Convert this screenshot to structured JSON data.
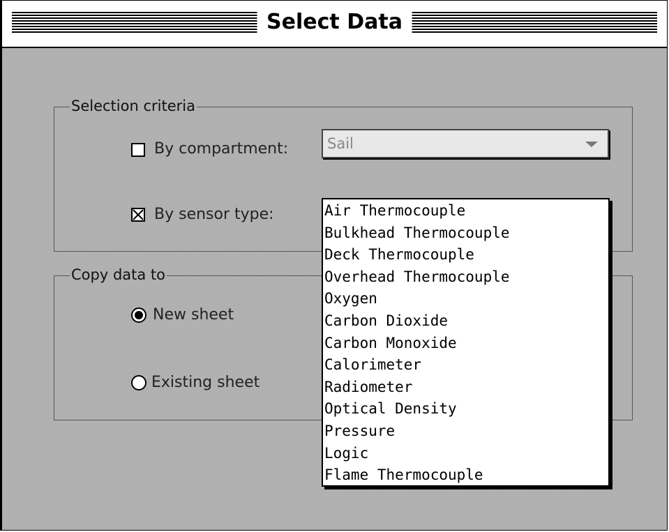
{
  "window": {
    "title": "Select Data"
  },
  "selection_criteria": {
    "label": "Selection criteria",
    "by_compartment": {
      "label": "By compartment:",
      "checked": false,
      "dropdown_value": "Sail"
    },
    "by_sensor_type": {
      "label": "By sensor type:",
      "checked": true
    }
  },
  "copy_data_to": {
    "label": "Copy data to",
    "new_sheet": {
      "label": "New sheet",
      "selected": true
    },
    "existing_sheet": {
      "label": "Existing sheet",
      "selected": false
    }
  },
  "sensor_list": {
    "items": [
      "Air Thermocouple",
      "Bulkhead Thermocouple",
      "Deck Thermocouple",
      "Overhead Thermocouple",
      "Oxygen",
      "Carbon Dioxide",
      "Carbon Monoxide",
      "Calorimeter",
      "Radiometer",
      "Optical Density",
      "Pressure",
      "Logic",
      "Flame Thermocouple"
    ]
  },
  "icons": {
    "checkbox_checked": "x-mark-icon",
    "dropdown": "triangle-down-icon"
  }
}
